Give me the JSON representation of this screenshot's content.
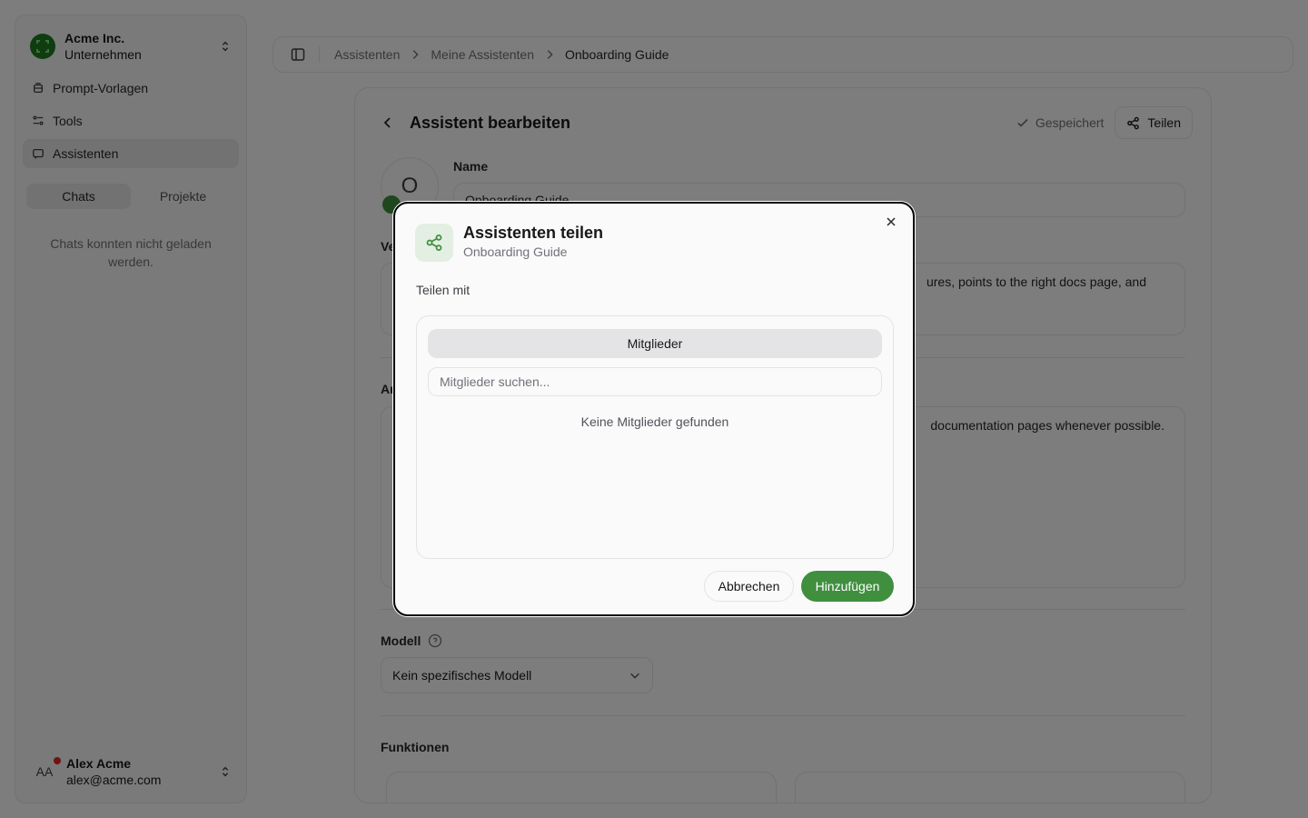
{
  "sidebar": {
    "org_name": "Acme Inc.",
    "org_type": "Unternehmen",
    "nav": [
      {
        "label": "Prompt-Vorlagen",
        "icon": "template-icon"
      },
      {
        "label": "Tools",
        "icon": "tools-icon"
      },
      {
        "label": "Assistenten",
        "icon": "assistant-icon",
        "active": true
      }
    ],
    "tabs": [
      {
        "label": "Chats",
        "active": true
      },
      {
        "label": "Projekte"
      }
    ],
    "empty_message": "Chats konnten nicht geladen werden.",
    "user": {
      "initials": "AA",
      "name": "Alex Acme",
      "email": "alex@acme.com"
    }
  },
  "breadcrumb": {
    "items": [
      "Assistenten",
      "Meine Assistenten",
      "Onboarding Guide"
    ]
  },
  "editor": {
    "title": "Assistent bearbeiten",
    "saved_label": "Gespeichert",
    "share_label": "Teilen",
    "avatar_letter": "O",
    "name_label": "Name",
    "name_value": "Onboarding Guide",
    "desc_label_partial": "Ve",
    "desc_visible": "ures, points to the right docs page, and",
    "instr_label_partial": "Ar",
    "instr_visible": "documentation pages whenever possible.",
    "model_label": "Modell",
    "model_value": "Kein spezifisches Modell",
    "functions_label": "Funktionen"
  },
  "modal": {
    "title": "Assistenten teilen",
    "subtitle": "Onboarding Guide",
    "share_with_label": "Teilen mit",
    "tab_label": "Mitglieder",
    "search_placeholder": "Mitglieder suchen...",
    "empty_text": "Keine Mitglieder gefunden",
    "cancel_label": "Abbrechen",
    "add_label": "Hinzufügen"
  },
  "colors": {
    "accent": "#3f8f3f",
    "overlay": "rgba(0,0,0,0.5)"
  }
}
